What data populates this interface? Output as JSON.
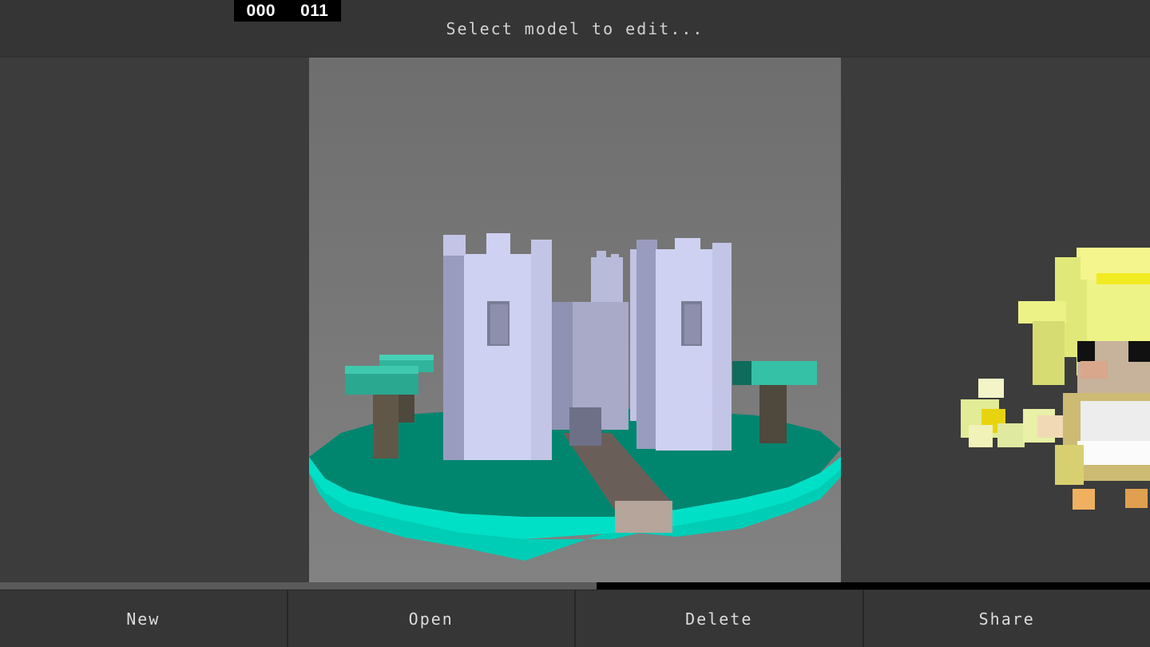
{
  "header": {
    "counter_left": "000",
    "counter_right": "011",
    "title": "Select model to edit..."
  },
  "carousel": {
    "current_model": "castle-model",
    "next_model": "voxel-character-model",
    "progress": 0.519
  },
  "toolbar": {
    "new_label": "New",
    "open_label": "Open",
    "delete_label": "Delete",
    "share_label": "Share"
  },
  "colors": {
    "background": "#3c3c3c",
    "header": "#353535",
    "viewport": "#767676",
    "grass": "#00856e",
    "grass_edge": "#00d9c0",
    "castle": "#c7c9e8",
    "tree_top": "#35c1a6",
    "tree_trunk": "#5b5346",
    "path": "#675c54"
  }
}
